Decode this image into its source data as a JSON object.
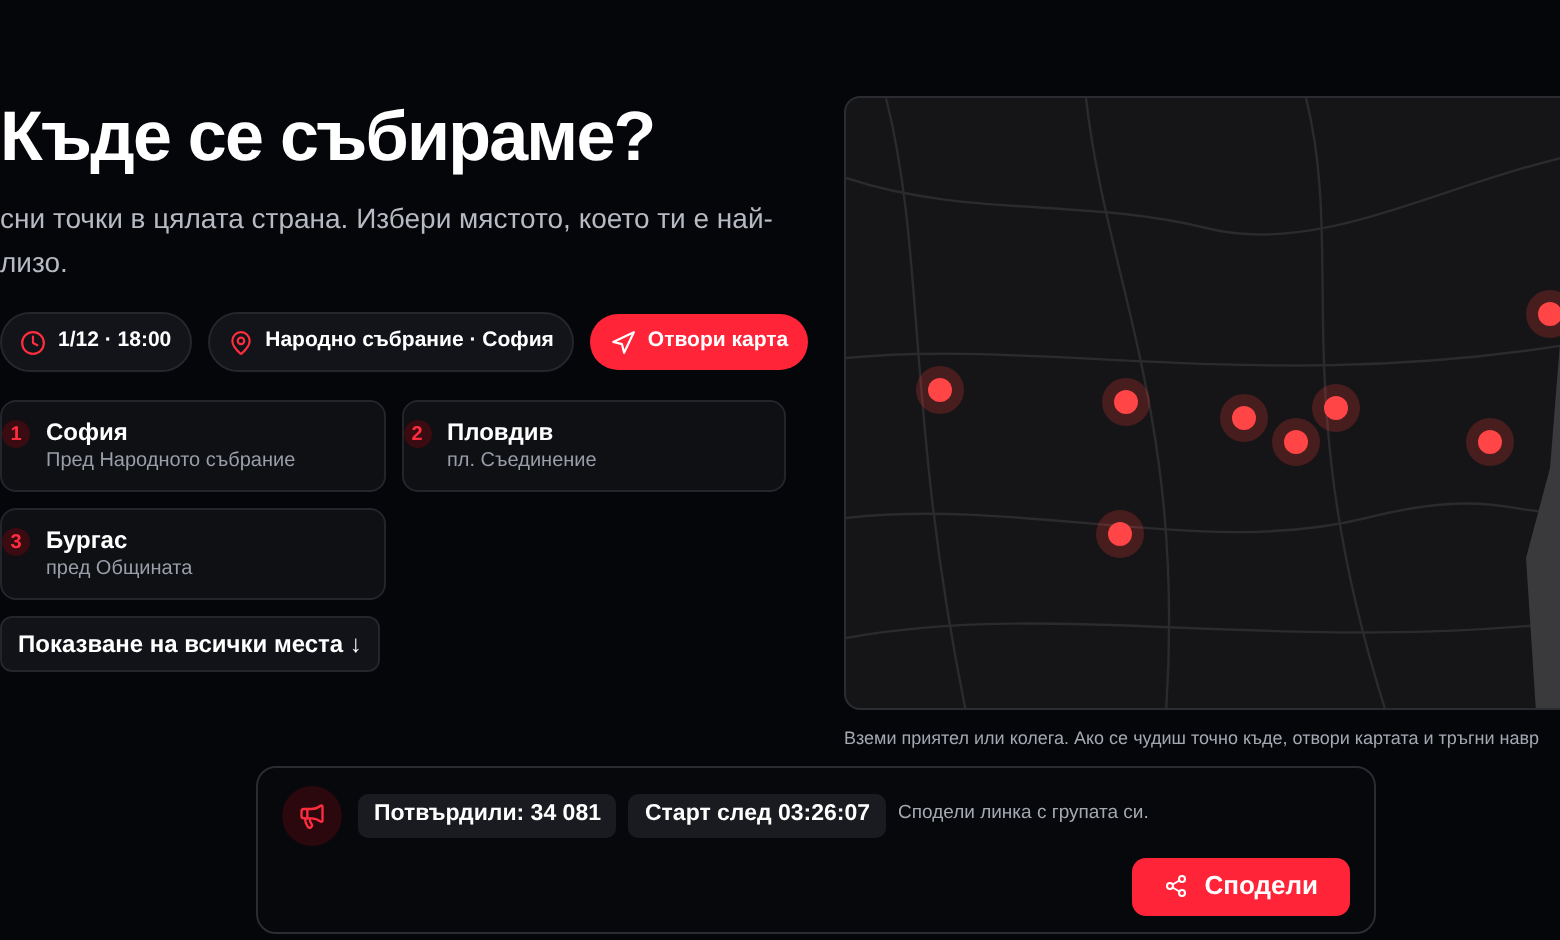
{
  "heading": "Къде се събираме?",
  "intro": "сни точки в цялата страна. Избери мястото, което ти е най-лизо.",
  "chips": [
    {
      "kind": "time",
      "label": "1/12 · 18:00"
    },
    {
      "kind": "place",
      "label": "Народно събрание · София"
    }
  ],
  "open_map_button": "Отвори карта",
  "locations": [
    {
      "number": "1",
      "city": "София",
      "spot": "Пред Народното събрание"
    },
    {
      "number": "2",
      "city": "Пловдив",
      "spot": "пл. Съединение"
    },
    {
      "number": "3",
      "city": "Бургас",
      "spot": "пред Общината"
    }
  ],
  "show_all_button": "Показване на всички места ↓",
  "map_caption": "Вземи приятел или колега. Ако се чудиш точно къде, отвори картата и тръгни навр",
  "bar": {
    "confirmed": "Потвърдили: 34 081",
    "countdown": "Старт след 03:26:07",
    "hint": "Сподели линка с групата си.",
    "share_button": "Сподели"
  }
}
